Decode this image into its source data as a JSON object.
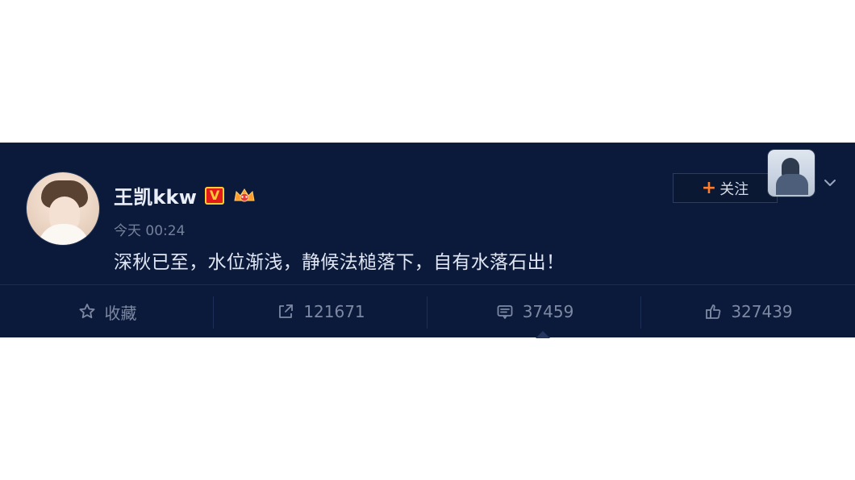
{
  "post": {
    "username": "王凯kkw",
    "verified_badge": "V",
    "crown_badge": "crown-icon",
    "time": "今天 00:24",
    "text": "深秋已至，水位渐浅，静候法槌落下，自有水落石出！",
    "follow_label": "关注",
    "follow_plus": "+",
    "menu_icon": "chevron-down-icon"
  },
  "actions": {
    "favorite": {
      "label": "收藏",
      "icon": "star-icon"
    },
    "repost": {
      "label": "121671",
      "icon": "repost-icon"
    },
    "comment": {
      "label": "37459",
      "icon": "comment-icon"
    },
    "like": {
      "label": "327439",
      "icon": "thumbs-up-icon"
    }
  },
  "colors": {
    "card_background": "#0b1a3a",
    "accent_plus": "#ff7d2b",
    "verified_red": "#e31b1b",
    "verified_gold": "#ffcc33"
  }
}
